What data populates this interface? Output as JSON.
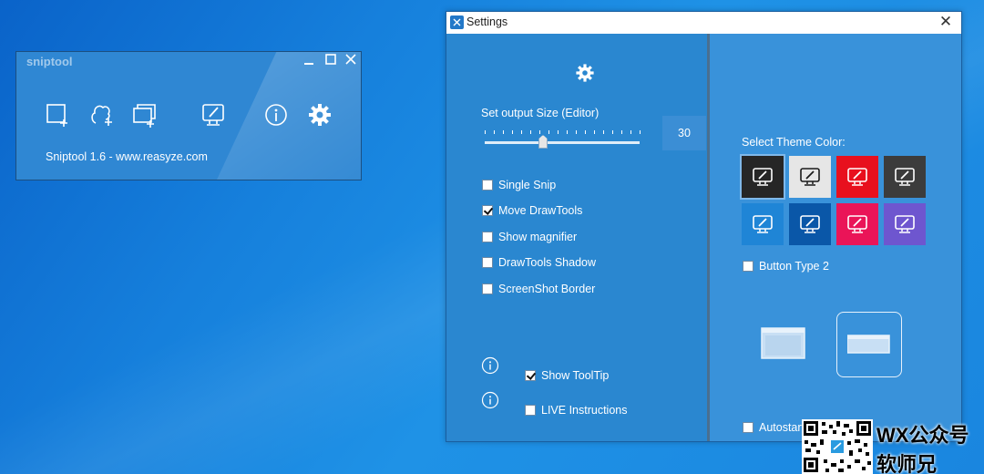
{
  "sniptool": {
    "title": "sniptool",
    "footer": "Sniptool 1.6 - www.reasyze.com",
    "tools": [
      "rectangle-snip-icon",
      "freeform-snip-icon",
      "window-snip-icon",
      "editor-icon",
      "info-icon",
      "settings-gear-icon"
    ]
  },
  "settings": {
    "title": "Settings",
    "close_glyph": "✕",
    "output_size_label": "Set output Size (Editor)",
    "output_size_value": "30",
    "options": [
      {
        "label": "Single Snip",
        "checked": false
      },
      {
        "label": "Move DrawTools",
        "checked": true
      },
      {
        "label": "Show magnifier",
        "checked": false
      },
      {
        "label": "DrawTools Shadow",
        "checked": false
      },
      {
        "label": "ScreenShot Border",
        "checked": false
      }
    ],
    "show_tooltip": {
      "label": "Show ToolTip",
      "checked": true
    },
    "live_instructions": {
      "label": "LIVE Instructions",
      "checked": false
    },
    "theme_label": "Select Theme Color:",
    "themes": [
      {
        "bg": "#262626",
        "fg": "#ffffff"
      },
      {
        "bg": "#e6e6e6",
        "fg": "#1a1a1a"
      },
      {
        "bg": "#e8101e",
        "fg": "#ffffff"
      },
      {
        "bg": "#3c3c3c",
        "fg": "#ffffff"
      },
      {
        "bg": "#1f85d6",
        "fg": "#ffffff"
      },
      {
        "bg": "#0a57a8",
        "fg": "#ffffff"
      },
      {
        "bg": "#ea1458",
        "fg": "#ffffff"
      },
      {
        "bg": "#6e56cf",
        "fg": "#ffffff"
      }
    ],
    "button_type_2": {
      "label": "Button Type 2",
      "checked": false
    },
    "autostart": {
      "label": "Autostart - (Beta)",
      "checked": false
    }
  },
  "watermark": {
    "line1": "WX公众号",
    "line2": "软师兄"
  }
}
